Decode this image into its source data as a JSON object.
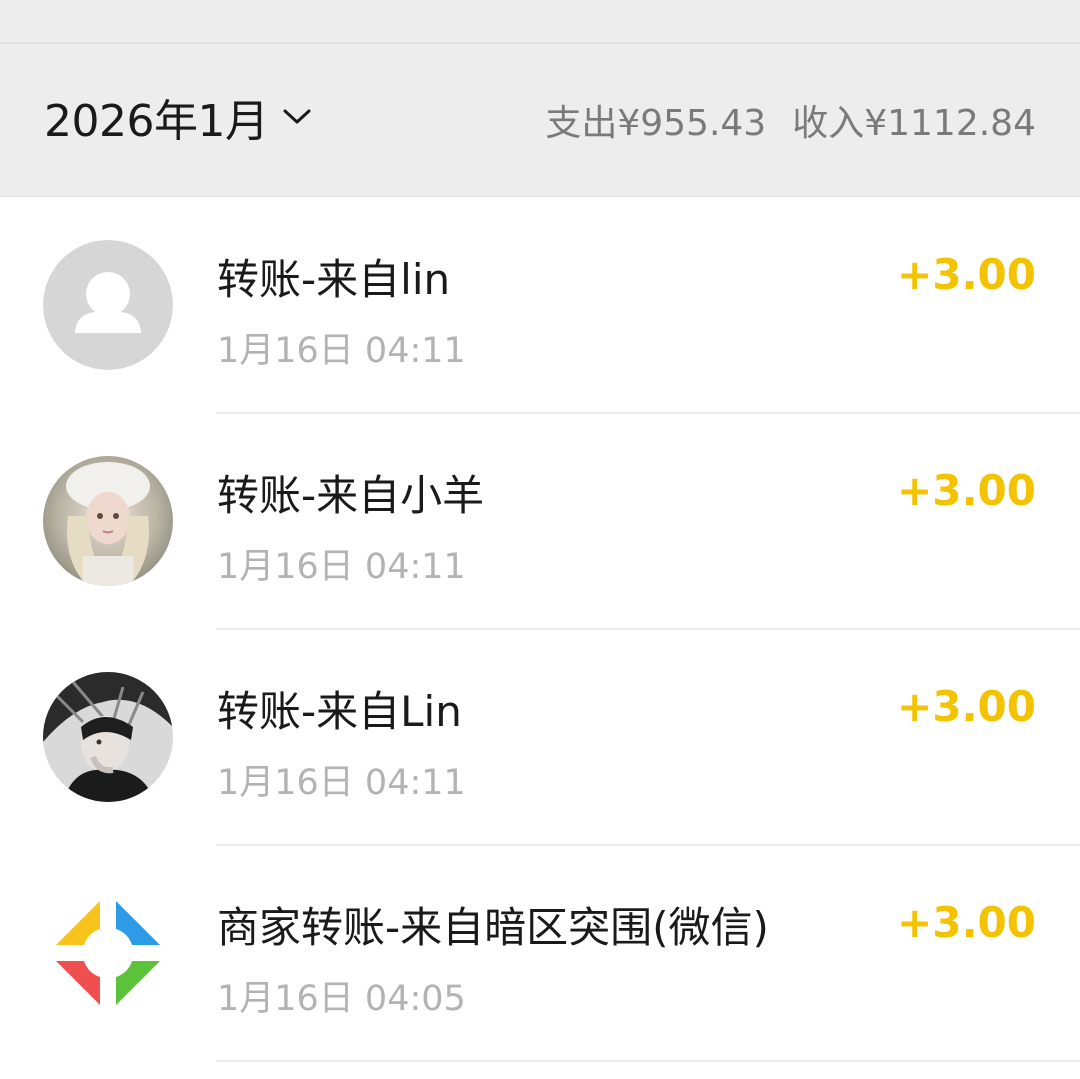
{
  "header": {
    "month": "2026年1月",
    "expense": "支出¥955.43",
    "income": "收入¥1112.84"
  },
  "transactions": [
    {
      "title": "转账-来自lin",
      "time": "1月16日 04:11",
      "amount": "+3.00",
      "avatar": "default-person-avatar"
    },
    {
      "title": "转账-来自小羊",
      "time": "1月16日 04:11",
      "amount": "+3.00",
      "avatar": "photo-avatar"
    },
    {
      "title": "转账-来自Lin",
      "time": "1月16日 04:11",
      "amount": "+3.00",
      "avatar": "photo-avatar"
    },
    {
      "title": "商家转账-来自暗区突围(微信)",
      "time": "1月16日 04:05",
      "amount": "+3.00",
      "avatar": "merchant-logo"
    }
  ],
  "colors": {
    "amount": "#f3c200",
    "header_bg": "#ededed"
  }
}
